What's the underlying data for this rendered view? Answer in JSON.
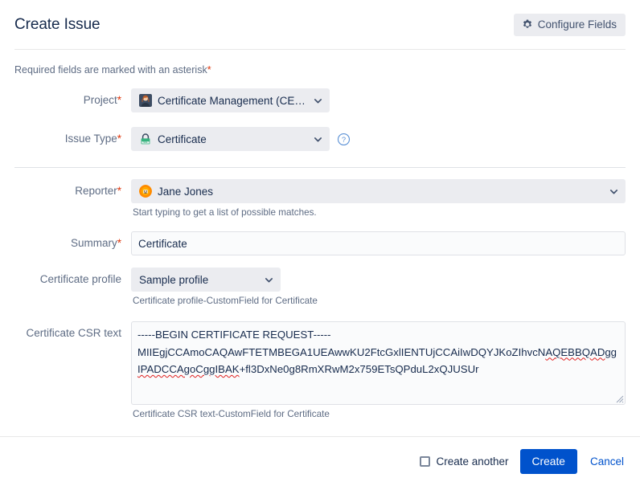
{
  "header": {
    "title": "Create Issue",
    "configure_fields_label": "Configure Fields",
    "gear_icon": "gear-icon"
  },
  "body": {
    "required_note": "Required fields are marked with an asterisk",
    "required_asterisk": "*"
  },
  "fields": {
    "project": {
      "label": "Project",
      "required_marker": "*",
      "value": "Certificate Management (CERT)",
      "icon": "project-avatar-icon",
      "chevron": "chevron-down-icon"
    },
    "issue_type": {
      "label": "Issue Type",
      "required_marker": "*",
      "value": "Certificate",
      "icon": "ssl-lock-icon",
      "chevron": "chevron-down-icon",
      "help_icon": "question-circle-icon"
    },
    "reporter": {
      "label": "Reporter",
      "required_marker": "*",
      "value": "Jane Jones",
      "icon": "user-avatar-icon",
      "chevron": "chevron-down-icon",
      "help_text": "Start typing to get a list of possible matches."
    },
    "summary": {
      "label": "Summary",
      "required_marker": "*",
      "value": "Certificate",
      "placeholder": ""
    },
    "certificate_profile": {
      "label": "Certificate profile",
      "value": "Sample profile",
      "chevron": "chevron-down-icon",
      "help_text": "Certificate profile-CustomField for Certificate"
    },
    "certificate_csr_text": {
      "label": "Certificate CSR text",
      "line1": "-----BEGIN CERTIFICATE REQUEST-----",
      "line2": "MIIEgjCCAmoCAQAwFTETMBEGA1UEAwwKU2FtcGxlIENTUjCCAiIwDQYJKoZIhvcN",
      "line3_misspelled": "AQEBBQADggIPADCCAgoCggIBAK",
      "line3_rest": "+fl3DxNe0g8RmXRwM2x759ETsQPduL2xQJUSUr",
      "help_text": "Certificate CSR text-CustomField for Certificate",
      "resize_grip": "resize-grip-icon"
    }
  },
  "footer": {
    "create_another_label": "Create another",
    "create_another_checked": false,
    "create_label": "Create",
    "cancel_label": "Cancel"
  },
  "colors": {
    "primary_button": "#0052cc",
    "link": "#0052cc",
    "required_asterisk": "#de350b",
    "field_bg": "#ebecf0",
    "input_bg": "#fafbfc",
    "input_border": "#dfe1e6",
    "label_text": "#5e6c84",
    "body_text": "#172b4d",
    "spellcheck_underline": "#e02020",
    "issue_type_icon": "#36b37e",
    "reporter_avatar": "#ff5630"
  }
}
